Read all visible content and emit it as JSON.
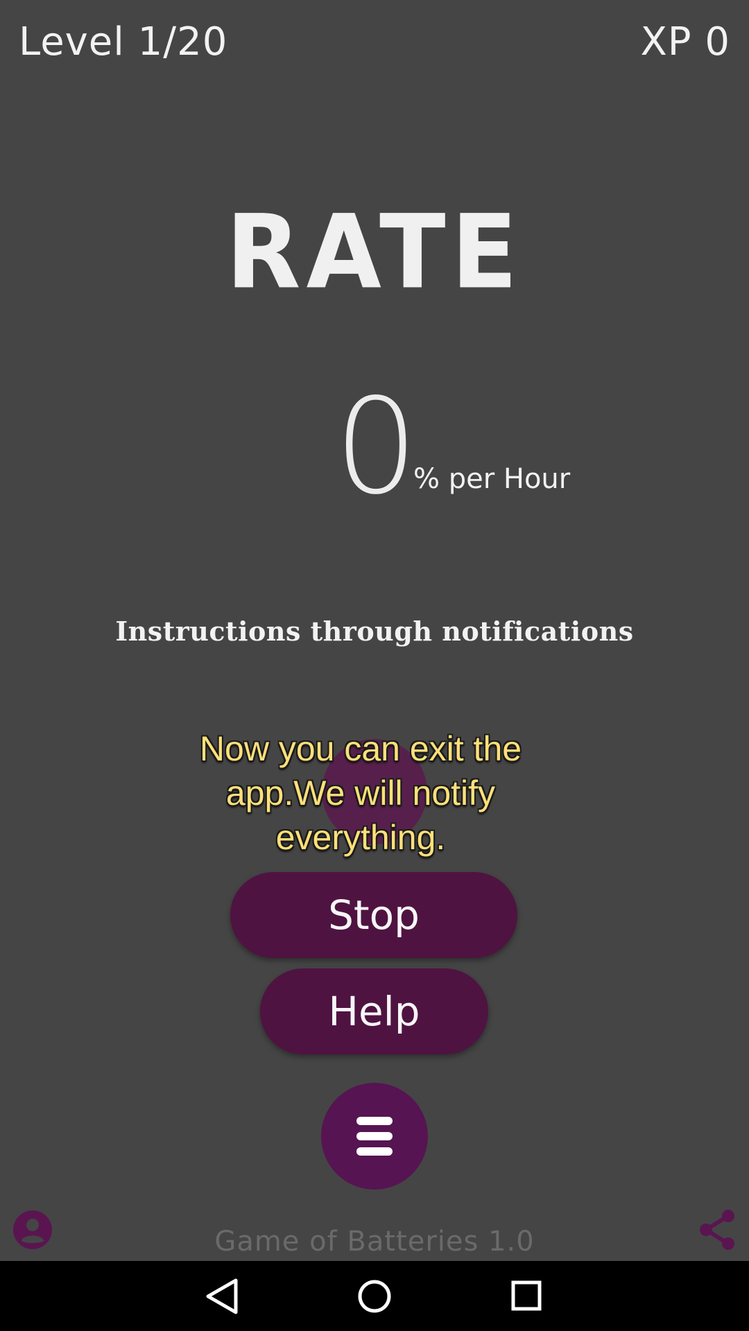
{
  "header": {
    "level_text": "Level 1/20",
    "xp_text": "XP 0"
  },
  "main": {
    "title": "RATE",
    "rate_value": "0",
    "rate_unit": "% per Hour",
    "instructions": "Instructions through notifications"
  },
  "toast": {
    "message": "Now you can exit the app.We will notify everything."
  },
  "buttons": {
    "stop_label": "Stop",
    "help_label": "Help"
  },
  "footer": {
    "version": "Game of Batteries 1.0"
  },
  "icons": {
    "menu": "hamburger-menu-icon",
    "profile": "account-circle-icon",
    "share": "share-icon",
    "nav_back": "back-triangle-icon",
    "nav_home": "home-circle-icon",
    "nav_recents": "recents-square-icon"
  },
  "colors": {
    "background": "#454545",
    "button": "#4f1341",
    "menu_button": "#561452",
    "toast_text": "#ffe07a",
    "accent_icon": "#5a1550"
  }
}
